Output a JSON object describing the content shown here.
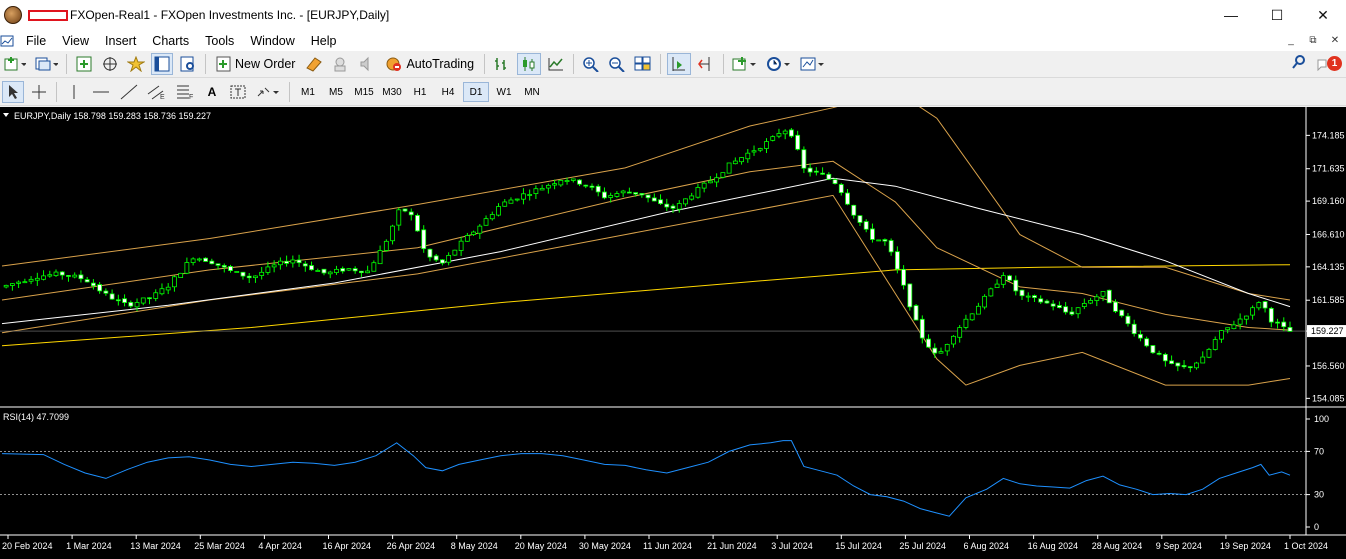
{
  "window": {
    "title": "FXOpen-Real1 - FXOpen Investments Inc. - [EURJPY,Daily]",
    "controls": [
      "—",
      "☐",
      "✕"
    ]
  },
  "menu": {
    "items": [
      "File",
      "View",
      "Insert",
      "Charts",
      "Tools",
      "Window",
      "Help"
    ],
    "mdi_controls": [
      "_",
      "⧉",
      "✕"
    ]
  },
  "toolbar": {
    "new_order_label": "New Order",
    "autotrading_label": "AutoTrading",
    "notification_count": "1",
    "icons": [
      "new-chart-icon",
      "profiles-icon",
      "market-watch-icon",
      "data-window-icon",
      "navigator-icon",
      "terminal-icon",
      "strategy-tester-icon",
      "metaeditor-icon",
      "sounds-icon",
      "bar-chart-icon",
      "candlesticks-icon",
      "line-chart-icon",
      "zoom-in-icon",
      "zoom-out-icon",
      "tile-windows-icon",
      "auto-scroll-icon",
      "chart-shift-icon",
      "indicators-icon",
      "periods-icon",
      "templates-icon",
      "search-icon"
    ]
  },
  "drawing_toolbar": {
    "tools": [
      "cursor-icon",
      "crosshair-icon",
      "vertical-line-icon",
      "horizontal-line-icon",
      "trendline-icon",
      "equidistant-channel-icon",
      "fibonacci-icon",
      "text-icon",
      "text-label-icon",
      "arrows-icon"
    ],
    "text_tool": "A",
    "timeframes": [
      "M1",
      "M5",
      "M15",
      "M30",
      "H1",
      "H4",
      "D1",
      "W1",
      "MN"
    ],
    "active_timeframe": "D1"
  },
  "chart": {
    "header": "EURJPY,Daily  158.798 159.283 158.736 159.227",
    "current_price": "159.227",
    "price_ticks": [
      "174.185",
      "171.635",
      "169.160",
      "166.610",
      "164.135",
      "161.585",
      "159.227",
      "156.560",
      "154.085"
    ],
    "rsi_label": "RSI(14) 47.7099",
    "rsi_ticks": [
      "100",
      "70",
      "30",
      "0"
    ],
    "date_labels": [
      "20 Feb 2024",
      "1 Mar 2024",
      "13 Mar 2024",
      "25 Mar 2024",
      "4 Apr 2024",
      "16 Apr 2024",
      "26 Apr 2024",
      "8 May 2024",
      "20 May 2024",
      "30 May 2024",
      "11 Jun 2024",
      "21 Jun 2024",
      "3 Jul 2024",
      "15 Jul 2024",
      "25 Jul 2024",
      "6 Aug 2024",
      "16 Aug 2024",
      "28 Aug 2024",
      "9 Sep 2024",
      "19 Sep 2024",
      "1 Oct 2024"
    ],
    "colors": {
      "background": "#000000",
      "bull": "#00ff00",
      "bear": "#ffffff",
      "ma_white": "#ffffff",
      "ma_long": "#ffd700",
      "bollinger": "#d9a24b",
      "rsi": "#1e90ff"
    }
  },
  "chart_data": {
    "type": "candlestick",
    "symbol": "EURJPY",
    "timeframe": "Daily",
    "ohlc_last": {
      "open": 158.798,
      "high": 159.283,
      "low": 158.736,
      "close": 159.227
    },
    "ylim": [
      153.5,
      176.2
    ],
    "close_path": [
      [
        0,
        162.6
      ],
      [
        8,
        163.4
      ],
      [
        14,
        163.6
      ],
      [
        20,
        163.2
      ],
      [
        25,
        162.0
      ],
      [
        30,
        161.2
      ],
      [
        36,
        161.8
      ],
      [
        40,
        162.7
      ],
      [
        46,
        164.9
      ],
      [
        50,
        164.6
      ],
      [
        55,
        163.8
      ],
      [
        60,
        163.3
      ],
      [
        66,
        164.3
      ],
      [
        70,
        164.7
      ],
      [
        74,
        164.1
      ],
      [
        78,
        163.6
      ],
      [
        83,
        164.0
      ],
      [
        88,
        163.8
      ],
      [
        92,
        165.8
      ],
      [
        96,
        168.7
      ],
      [
        99,
        167.9
      ],
      [
        102,
        165.0
      ],
      [
        106,
        164.4
      ],
      [
        110,
        165.8
      ],
      [
        115,
        167.3
      ],
      [
        120,
        168.9
      ],
      [
        125,
        169.6
      ],
      [
        130,
        170.2
      ],
      [
        135,
        170.9
      ],
      [
        140,
        170.5
      ],
      [
        145,
        169.5
      ],
      [
        150,
        169.9
      ],
      [
        154,
        169.7
      ],
      [
        158,
        168.9
      ],
      [
        162,
        168.6
      ],
      [
        166,
        169.7
      ],
      [
        170,
        170.6
      ],
      [
        175,
        171.9
      ],
      [
        180,
        172.9
      ],
      [
        185,
        173.8
      ],
      [
        188,
        174.7
      ],
      [
        190,
        174.3
      ],
      [
        193,
        171.6
      ],
      [
        197,
        171.2
      ],
      [
        201,
        170.5
      ],
      [
        205,
        168.2
      ],
      [
        209,
        166.4
      ],
      [
        213,
        166.0
      ],
      [
        217,
        162.6
      ],
      [
        221,
        159.0
      ],
      [
        225,
        157.2
      ],
      [
        229,
        159.0
      ],
      [
        233,
        160.5
      ],
      [
        237,
        161.9
      ],
      [
        241,
        163.6
      ],
      [
        245,
        161.9
      ],
      [
        249,
        161.6
      ],
      [
        253,
        161.2
      ],
      [
        257,
        160.5
      ],
      [
        261,
        161.5
      ],
      [
        265,
        162.1
      ],
      [
        269,
        160.5
      ],
      [
        273,
        159.0
      ],
      [
        277,
        157.7
      ],
      [
        281,
        156.6
      ],
      [
        285,
        156.4
      ],
      [
        289,
        157.1
      ],
      [
        293,
        159.0
      ],
      [
        297,
        159.9
      ],
      [
        301,
        160.9
      ],
      [
        303,
        161.7
      ],
      [
        305,
        160.2
      ],
      [
        308,
        159.5
      ],
      [
        310,
        159.2
      ]
    ],
    "ma_white": [
      [
        0,
        159.8
      ],
      [
        40,
        161.2
      ],
      [
        80,
        162.9
      ],
      [
        120,
        165.3
      ],
      [
        160,
        168.3
      ],
      [
        200,
        170.9
      ],
      [
        215,
        170.3
      ],
      [
        235,
        168.6
      ],
      [
        260,
        166.6
      ],
      [
        280,
        164.6
      ],
      [
        300,
        162.1
      ],
      [
        310,
        161.1
      ]
    ],
    "ma_long": [
      [
        0,
        158.1
      ],
      [
        60,
        159.5
      ],
      [
        120,
        161.4
      ],
      [
        180,
        163.0
      ],
      [
        215,
        163.9
      ],
      [
        250,
        164.1
      ],
      [
        310,
        164.3
      ]
    ],
    "bb_upper": [
      [
        0,
        164.2
      ],
      [
        50,
        166.3
      ],
      [
        100,
        168.9
      ],
      [
        150,
        171.7
      ],
      [
        180,
        174.9
      ],
      [
        200,
        176.3
      ],
      [
        215,
        177.6
      ],
      [
        225,
        175.5
      ],
      [
        245,
        166.6
      ],
      [
        260,
        164.1
      ],
      [
        280,
        164.1
      ],
      [
        300,
        162.1
      ],
      [
        310,
        161.6
      ]
    ],
    "bb_mid": [
      [
        0,
        161.6
      ],
      [
        50,
        163.9
      ],
      [
        100,
        165.6
      ],
      [
        150,
        169.4
      ],
      [
        180,
        171.4
      ],
      [
        200,
        172.2
      ],
      [
        215,
        169.1
      ],
      [
        225,
        165.6
      ],
      [
        245,
        162.6
      ],
      [
        260,
        162.1
      ],
      [
        280,
        160.5
      ],
      [
        300,
        159.5
      ],
      [
        310,
        159.3
      ]
    ],
    "bb_lower": [
      [
        0,
        159.1
      ],
      [
        50,
        161.6
      ],
      [
        100,
        163.6
      ],
      [
        150,
        166.6
      ],
      [
        180,
        168.4
      ],
      [
        200,
        169.6
      ],
      [
        215,
        162.1
      ],
      [
        225,
        157.1
      ],
      [
        232,
        155.1
      ],
      [
        245,
        156.6
      ],
      [
        260,
        157.6
      ],
      [
        280,
        155.1
      ],
      [
        300,
        155.1
      ],
      [
        310,
        155.6
      ]
    ],
    "rsi": {
      "label": "RSI(14)",
      "value": 47.7099,
      "levels": [
        70,
        30
      ],
      "ylim": [
        0,
        100
      ],
      "points": [
        [
          0,
          68
        ],
        [
          10,
          67
        ],
        [
          15,
          58
        ],
        [
          20,
          50
        ],
        [
          25,
          45
        ],
        [
          30,
          53
        ],
        [
          35,
          60
        ],
        [
          40,
          64
        ],
        [
          45,
          65
        ],
        [
          50,
          62
        ],
        [
          55,
          58
        ],
        [
          60,
          56
        ],
        [
          65,
          58
        ],
        [
          70,
          60
        ],
        [
          75,
          59
        ],
        [
          80,
          57
        ],
        [
          85,
          60
        ],
        [
          90,
          66
        ],
        [
          95,
          78
        ],
        [
          99,
          66
        ],
        [
          102,
          55
        ],
        [
          106,
          52
        ],
        [
          110,
          58
        ],
        [
          115,
          62
        ],
        [
          120,
          66
        ],
        [
          125,
          68
        ],
        [
          130,
          68
        ],
        [
          135,
          66
        ],
        [
          140,
          62
        ],
        [
          145,
          58
        ],
        [
          150,
          57
        ],
        [
          155,
          53
        ],
        [
          160,
          50
        ],
        [
          165,
          55
        ],
        [
          170,
          60
        ],
        [
          175,
          70
        ],
        [
          180,
          76
        ],
        [
          185,
          78
        ],
        [
          188,
          80
        ],
        [
          190,
          80
        ],
        [
          193,
          56
        ],
        [
          197,
          52
        ],
        [
          201,
          48
        ],
        [
          205,
          38
        ],
        [
          209,
          30
        ],
        [
          213,
          28
        ],
        [
          217,
          24
        ],
        [
          221,
          17
        ],
        [
          225,
          13
        ],
        [
          228,
          10
        ],
        [
          232,
          27
        ],
        [
          237,
          35
        ],
        [
          241,
          45
        ],
        [
          245,
          40
        ],
        [
          249,
          38
        ],
        [
          253,
          37
        ],
        [
          257,
          36
        ],
        [
          261,
          43
        ],
        [
          265,
          47
        ],
        [
          269,
          39
        ],
        [
          273,
          35
        ],
        [
          277,
          30
        ],
        [
          281,
          31
        ],
        [
          285,
          30
        ],
        [
          289,
          35
        ],
        [
          293,
          45
        ],
        [
          297,
          50
        ],
        [
          301,
          55
        ],
        [
          303,
          58
        ],
        [
          305,
          48
        ],
        [
          308,
          51
        ],
        [
          310,
          48
        ]
      ]
    }
  }
}
